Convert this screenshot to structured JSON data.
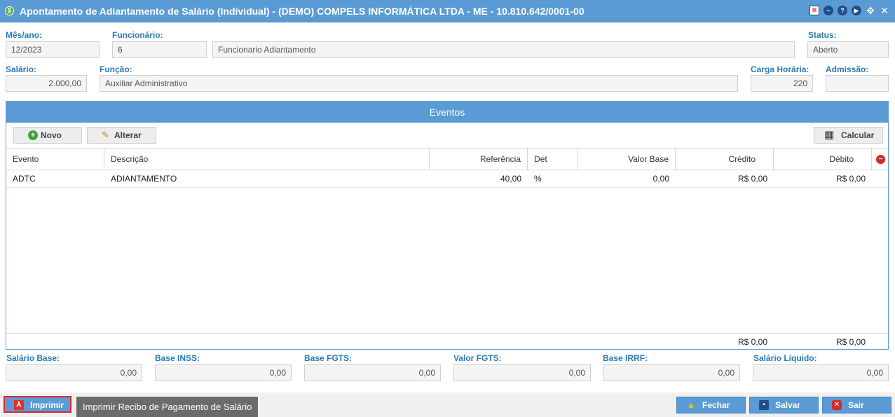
{
  "window": {
    "title": "Apontamento de Adiantamento de Salário (Individual) - (DEMO) COMPELS INFORMÁTICA LTDA - ME - 10.810.642/0001-00"
  },
  "header": {
    "mes_ano_label": "Mês/ano:",
    "mes_ano_value": "12/2023",
    "funcionario_label": "Funcionário:",
    "funcionario_code": "6",
    "funcionario_name": "Funcionario Adiantamento",
    "status_label": "Status:",
    "status_value": "Aberto",
    "salario_label": "Salário:",
    "salario_value": "2.000,00",
    "funcao_label": "Função:",
    "funcao_value": "Auxiliar Administrativo",
    "carga_label": "Carga Horária:",
    "carga_value": "220",
    "admissao_label": "Admissão:",
    "admissao_value": ""
  },
  "eventos": {
    "title": "Eventos",
    "toolbar": {
      "novo": "Novo",
      "alterar": "Alterar",
      "calcular": "Calcular"
    },
    "columns": [
      "Evento",
      "Descrição",
      "Referência",
      "Det",
      "Valor Base",
      "Crédito",
      "Débito"
    ],
    "rows": [
      [
        "ADTC",
        "ADIANTAMENTO",
        "40,00",
        "%",
        "0,00",
        "R$ 0,00",
        "R$ 0,00"
      ]
    ],
    "totals": {
      "credito": "R$ 0,00",
      "debito": "R$ 0,00"
    }
  },
  "summary": {
    "salario_base_label": "Salário Base:",
    "salario_base_value": "0,00",
    "base_inss_label": "Base INSS:",
    "base_inss_value": "0,00",
    "base_fgts_label": "Base FGTS:",
    "base_fgts_value": "0,00",
    "valor_fgts_label": "Valor FGTS:",
    "valor_fgts_value": "0,00",
    "base_irrf_label": "Base IRRF:",
    "base_irrf_value": "0,00",
    "salario_liquido_label": "Salário Líquido:",
    "salario_liquido_value": "0,00"
  },
  "footer": {
    "imprimir": "Imprimir",
    "tooltip": "Imprimir Recibo de Pagamento de Salário",
    "fechar": "Fechar",
    "salvar": "Salvar",
    "sair": "Sair"
  },
  "colors": {
    "accent": "#5b9bd5",
    "label": "#2a7ab8",
    "highlight_border": "#e0262b"
  }
}
